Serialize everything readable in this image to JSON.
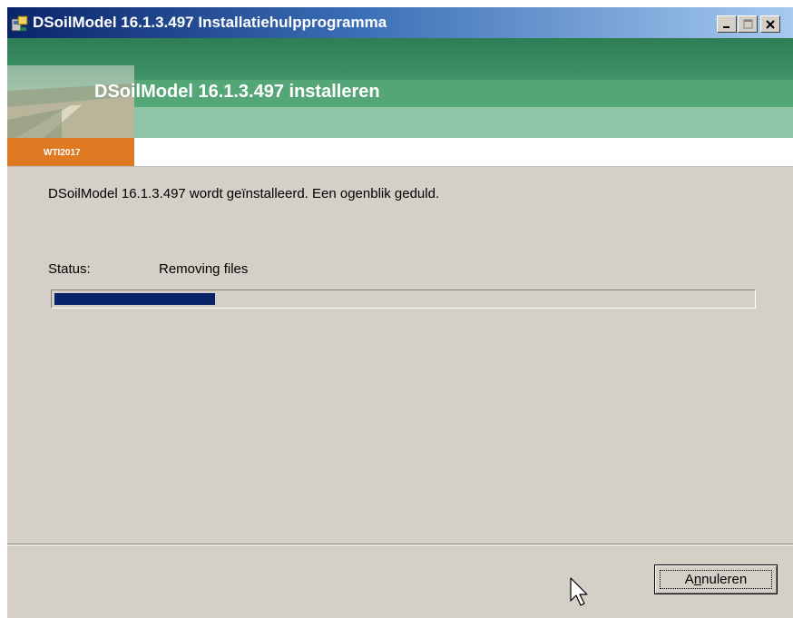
{
  "window": {
    "title": "DSoilModel 16.1.3.497 Installatiehulpprogramma",
    "icons": {
      "app": "installer-icon",
      "minimize": "minimize-icon",
      "maximize": "maximize-icon",
      "close": "close-icon"
    }
  },
  "banner": {
    "title": "DSoilModel 16.1.3.497 installeren",
    "tab_label": "WTI2017",
    "colors": {
      "green_dark": "#2e7d55",
      "green_light": "#8fc4a6",
      "orange": "#e07a22"
    }
  },
  "main": {
    "description": "DSoilModel 16.1.3.497 wordt geïnstalleerd. Een ogenblik geduld.",
    "status_label": "Status:",
    "status_value": "Removing files",
    "progress_percent": 23
  },
  "footer": {
    "cancel_label": "Annuleren",
    "cancel_mnemonic": "n"
  },
  "colors": {
    "titlebar": "#0a246a",
    "dialog_bg": "#d4d0c8",
    "progress": "#0a246a"
  }
}
